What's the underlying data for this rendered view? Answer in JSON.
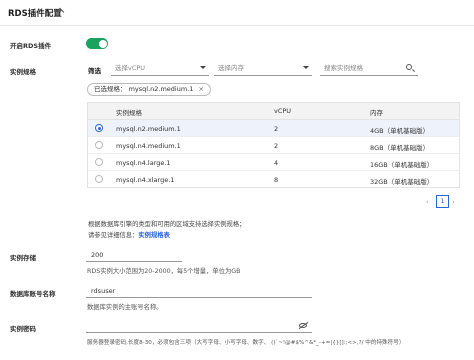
{
  "header": {
    "title": "RDS插件配置"
  },
  "enable": {
    "label": "开启RDS插件",
    "on": true
  },
  "spec": {
    "label": "实例规格",
    "filter_label": "筛选",
    "vcpu_placeholder": "选择vCPU",
    "memory_placeholder": "选择内存",
    "search_placeholder": "搜索实例规格",
    "selected_chip": "已选规格： mysql.n2.medium.1",
    "chip_close": "×",
    "columns": [
      "实例规格",
      "vCPU",
      "内存"
    ],
    "rows": [
      {
        "spec": "mysql.n2.medium.1",
        "vcpu": "2",
        "mem": "4GB（单机基础版）",
        "selected": true
      },
      {
        "spec": "mysql.n4.medium.1",
        "vcpu": "2",
        "mem": "8GB（单机基础版）",
        "selected": false
      },
      {
        "spec": "mysql.n4.large.1",
        "vcpu": "4",
        "mem": "16GB（单机基础版）",
        "selected": false
      },
      {
        "spec": "mysql.n4.xlarge.1",
        "vcpu": "8",
        "mem": "32GB（单机基础版）",
        "selected": false
      }
    ],
    "pagination": {
      "prev": "‹",
      "current": "1",
      "next": "›"
    },
    "note1": "根据数据库引擎的类型和可用的区域支持选择实例规格；",
    "note2_prefix": "请参见详细信息：",
    "note2_link": "实例规格表"
  },
  "storage": {
    "label": "实例存储",
    "value": "200",
    "hint": "RDS实例大小范围为20-2000，每5个增量，单位为GB"
  },
  "account": {
    "label": "数据库账号名称",
    "value": "rdsuser",
    "hint": "数据库实例的主账号名称。"
  },
  "password": {
    "label": "实例密码",
    "value": "",
    "hint": "服务器登录密码,长度8-30，必须包含三项（大写字母、小写字母、数字、 ()`~!@#$%^&*_-+=|{}[]:;<>,?/ 中的特殊符号）"
  },
  "colors": {
    "accent": "#2a65d6",
    "toggle": "#1aa260"
  }
}
